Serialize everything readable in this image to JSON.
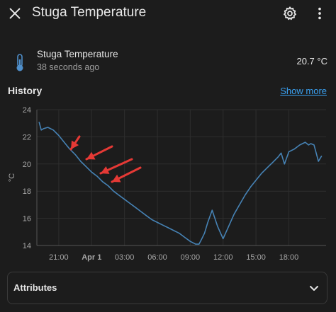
{
  "header": {
    "title": "Stuga Temperature",
    "icons": [
      "close-icon",
      "gear-icon",
      "more-vertical-icon"
    ]
  },
  "entity": {
    "icon": "thermometer-icon",
    "name": "Stuga Temperature",
    "last_changed": "38 seconds ago",
    "state": "20.7 °C"
  },
  "history": {
    "title": "History",
    "show_more_label": "Show more"
  },
  "chart_data": {
    "type": "line",
    "ylabel": "°C",
    "ylim": [
      14,
      24
    ],
    "y_ticks": [
      "24",
      "22",
      "20",
      "18",
      "16",
      "14"
    ],
    "x_ticks": [
      "21:00",
      "Apr 1",
      "03:00",
      "06:00",
      "09:00",
      "12:00",
      "15:00",
      "18:00"
    ],
    "line_color": "#4682b4",
    "annotation_color": "#e53935",
    "series": [
      {
        "x_hours": [
          19.2,
          19.4,
          19.6,
          20.0,
          20.5,
          21.0,
          21.5,
          22.0,
          22.5,
          23.0,
          23.5,
          24.0,
          24.5,
          25.0,
          25.5,
          26.0,
          26.5,
          27.0,
          27.5,
          28.0,
          28.5,
          29.0,
          29.5,
          30.0,
          30.5,
          31.0,
          31.5,
          32.0,
          32.5,
          33.0,
          33.5,
          33.8,
          34.0,
          34.3,
          34.6,
          35.0,
          35.5,
          36.0,
          36.5,
          37.0,
          37.5,
          38.0,
          38.5,
          39.0,
          39.5,
          40.0,
          40.5,
          41.0,
          41.3,
          41.6,
          42.0,
          42.5,
          43.0,
          43.5,
          43.8,
          44.0,
          44.3,
          44.7,
          45.0
        ],
        "values": [
          23.1,
          22.5,
          22.6,
          22.7,
          22.5,
          22.1,
          21.6,
          21.1,
          20.7,
          20.2,
          19.8,
          19.4,
          19.1,
          18.7,
          18.4,
          18.0,
          17.7,
          17.4,
          17.1,
          16.8,
          16.5,
          16.2,
          15.9,
          15.7,
          15.5,
          15.3,
          15.1,
          14.9,
          14.6,
          14.3,
          14.1,
          14.1,
          14.4,
          14.9,
          15.7,
          16.6,
          15.4,
          14.5,
          15.4,
          16.3,
          17.0,
          17.7,
          18.3,
          18.8,
          19.3,
          19.7,
          20.1,
          20.5,
          20.8,
          20.0,
          20.9,
          21.1,
          21.4,
          21.6,
          21.4,
          21.5,
          21.4,
          20.2,
          20.6
        ]
      }
    ],
    "annotations": [
      "arrow",
      "arrow",
      "arrow",
      "arrow"
    ]
  },
  "attributes": {
    "label": "Attributes",
    "chevron_icon": "chevron-down-icon"
  }
}
